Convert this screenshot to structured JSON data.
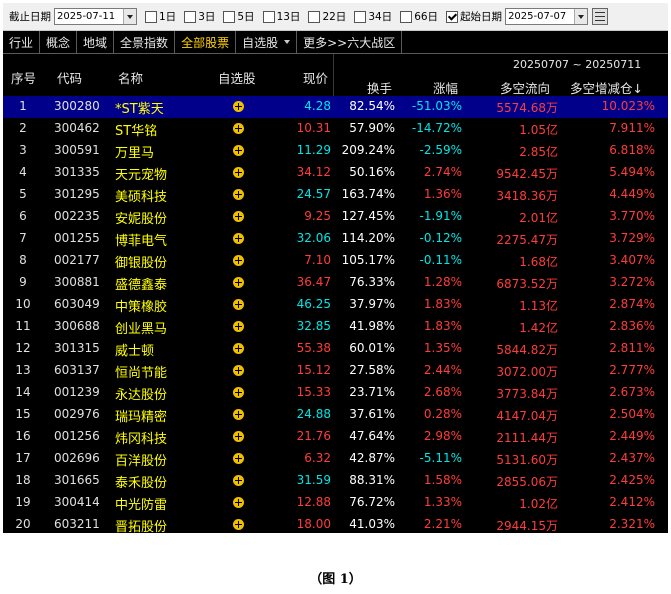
{
  "toolbar": {
    "end_date_label": "截止日期",
    "end_date_value": "2025-07-11",
    "periods": [
      {
        "label": "1日",
        "checked": false
      },
      {
        "label": "3日",
        "checked": false
      },
      {
        "label": "5日",
        "checked": false
      },
      {
        "label": "13日",
        "checked": false
      },
      {
        "label": "22日",
        "checked": false
      },
      {
        "label": "34日",
        "checked": false
      },
      {
        "label": "66日",
        "checked": false
      }
    ],
    "start_date_checked": true,
    "start_date_label": "起始日期",
    "start_date_value": "2025-07-07"
  },
  "tabs": [
    {
      "label": "行业"
    },
    {
      "label": "概念"
    },
    {
      "label": "地域"
    },
    {
      "label": "全景指数"
    },
    {
      "label": "全部股票",
      "active": true
    },
    {
      "label": "自选股",
      "dropdown": true
    },
    {
      "label": "更多>>六大战区"
    }
  ],
  "header": {
    "seq": "序号",
    "code": "代码",
    "name": "名称",
    "fav": "自选股",
    "price": "现价",
    "range": "20250707 ~ 20250711",
    "turnover": "换手",
    "change": "涨幅",
    "flow": "多空流向",
    "ratio": "多空增减仓↓"
  },
  "colors": {
    "up": "#ff3c3c",
    "down": "#00e6e6",
    "name": "#ffff00",
    "selected_row": "#00008b"
  },
  "rows": [
    {
      "seq": "1",
      "code": "300280",
      "name": "*ST紫天",
      "price": "4.28",
      "turnover": "82.54%",
      "change": "-51.03%",
      "flow": "5574.68万",
      "ratio": "10.023%",
      "dir": "down"
    },
    {
      "seq": "2",
      "code": "300462",
      "name": "ST华铭",
      "price": "10.31",
      "turnover": "57.90%",
      "change": "-14.72%",
      "flow": "1.05亿",
      "ratio": "7.911%",
      "dir": "up"
    },
    {
      "seq": "3",
      "code": "300591",
      "name": "万里马",
      "price": "11.29",
      "turnover": "209.24%",
      "change": "-2.59%",
      "flow": "2.85亿",
      "ratio": "6.818%",
      "dir": "down"
    },
    {
      "seq": "4",
      "code": "301335",
      "name": "天元宠物",
      "price": "34.12",
      "turnover": "50.16%",
      "change": "2.74%",
      "flow": "9542.45万",
      "ratio": "5.494%",
      "dir": "up"
    },
    {
      "seq": "5",
      "code": "301295",
      "name": "美硕科技",
      "price": "24.57",
      "turnover": "163.74%",
      "change": "1.36%",
      "flow": "3418.36万",
      "ratio": "4.449%",
      "dir": "down"
    },
    {
      "seq": "6",
      "code": "002235",
      "name": "安妮股份",
      "price": "9.25",
      "turnover": "127.45%",
      "change": "-1.91%",
      "flow": "2.01亿",
      "ratio": "3.770%",
      "dir": "up"
    },
    {
      "seq": "7",
      "code": "001255",
      "name": "博菲电气",
      "price": "32.06",
      "turnover": "114.20%",
      "change": "-0.12%",
      "flow": "2275.47万",
      "ratio": "3.729%",
      "dir": "down"
    },
    {
      "seq": "8",
      "code": "002177",
      "name": "御银股份",
      "price": "7.10",
      "turnover": "105.17%",
      "change": "-0.11%",
      "flow": "1.68亿",
      "ratio": "3.407%",
      "dir": "up"
    },
    {
      "seq": "9",
      "code": "300881",
      "name": "盛德鑫泰",
      "price": "36.47",
      "turnover": "76.33%",
      "change": "1.28%",
      "flow": "6873.52万",
      "ratio": "3.272%",
      "dir": "up"
    },
    {
      "seq": "10",
      "code": "603049",
      "name": "中策橡胶",
      "price": "46.25",
      "turnover": "37.97%",
      "change": "1.83%",
      "flow": "1.13亿",
      "ratio": "2.874%",
      "dir": "down"
    },
    {
      "seq": "11",
      "code": "300688",
      "name": "创业黑马",
      "price": "32.85",
      "turnover": "41.98%",
      "change": "1.83%",
      "flow": "1.42亿",
      "ratio": "2.836%",
      "dir": "down"
    },
    {
      "seq": "12",
      "code": "301315",
      "name": "威士顿",
      "price": "55.38",
      "turnover": "60.01%",
      "change": "1.35%",
      "flow": "5844.82万",
      "ratio": "2.811%",
      "dir": "up"
    },
    {
      "seq": "13",
      "code": "603137",
      "name": "恒尚节能",
      "price": "15.12",
      "turnover": "27.58%",
      "change": "2.44%",
      "flow": "3072.00万",
      "ratio": "2.777%",
      "dir": "up"
    },
    {
      "seq": "14",
      "code": "001239",
      "name": "永达股份",
      "price": "15.33",
      "turnover": "23.71%",
      "change": "2.68%",
      "flow": "3773.84万",
      "ratio": "2.673%",
      "dir": "up"
    },
    {
      "seq": "15",
      "code": "002976",
      "name": "瑞玛精密",
      "price": "24.88",
      "turnover": "37.61%",
      "change": "0.28%",
      "flow": "4147.04万",
      "ratio": "2.504%",
      "dir": "down"
    },
    {
      "seq": "16",
      "code": "001256",
      "name": "炜冈科技",
      "price": "21.76",
      "turnover": "47.64%",
      "change": "2.98%",
      "flow": "2111.44万",
      "ratio": "2.449%",
      "dir": "up"
    },
    {
      "seq": "17",
      "code": "002696",
      "name": "百洋股份",
      "price": "6.32",
      "turnover": "42.87%",
      "change": "-5.11%",
      "flow": "5131.60万",
      "ratio": "2.437%",
      "dir": "up"
    },
    {
      "seq": "18",
      "code": "301665",
      "name": "泰禾股份",
      "price": "31.59",
      "turnover": "88.31%",
      "change": "1.58%",
      "flow": "2855.06万",
      "ratio": "2.425%",
      "dir": "down"
    },
    {
      "seq": "19",
      "code": "300414",
      "name": "中光防雷",
      "price": "12.88",
      "turnover": "76.72%",
      "change": "1.33%",
      "flow": "1.02亿",
      "ratio": "2.412%",
      "dir": "up"
    },
    {
      "seq": "20",
      "code": "603211",
      "name": "晋拓股份",
      "price": "18.00",
      "turnover": "41.03%",
      "change": "2.21%",
      "flow": "2944.15万",
      "ratio": "2.321%",
      "dir": "up"
    }
  ],
  "caption": "（图 1）"
}
